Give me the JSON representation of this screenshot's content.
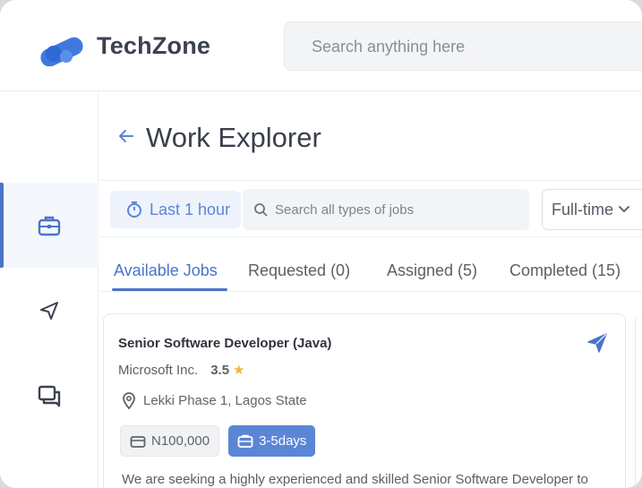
{
  "app": {
    "brand": "TechZone",
    "search_placeholder": "Search anything here",
    "colors": {
      "accent": "#4a74c9",
      "accent_light": "#5b86d6",
      "star": "#f0b53a",
      "logo": "#3f79e0"
    }
  },
  "sidebar": {
    "items": [
      {
        "icon": "briefcase-icon",
        "active": true
      },
      {
        "icon": "send-icon",
        "active": false
      },
      {
        "icon": "chat-icon",
        "active": false
      }
    ]
  },
  "page": {
    "title": "Work Explorer",
    "back_icon": "arrow-left-icon"
  },
  "filters": {
    "time_label": "Last 1 hour",
    "search_placeholder": "Search all types of jobs",
    "job_type": "Full-time"
  },
  "tabs": [
    {
      "label": "Available Jobs",
      "active": true
    },
    {
      "label": "Requested (0)",
      "active": false
    },
    {
      "label": "Assigned (5)",
      "active": false
    },
    {
      "label": "Completed (15)",
      "active": false
    }
  ],
  "job_card": {
    "title": "Senior Software Developer (Java)",
    "company": "Microsoft Inc.",
    "rating": "3.5",
    "location": "Lekki Phase 1, Lagos State",
    "pay": "N100,000",
    "duration": "3-5days",
    "description": "We are seeking a highly experienced and skilled Senior Software Developer to"
  }
}
